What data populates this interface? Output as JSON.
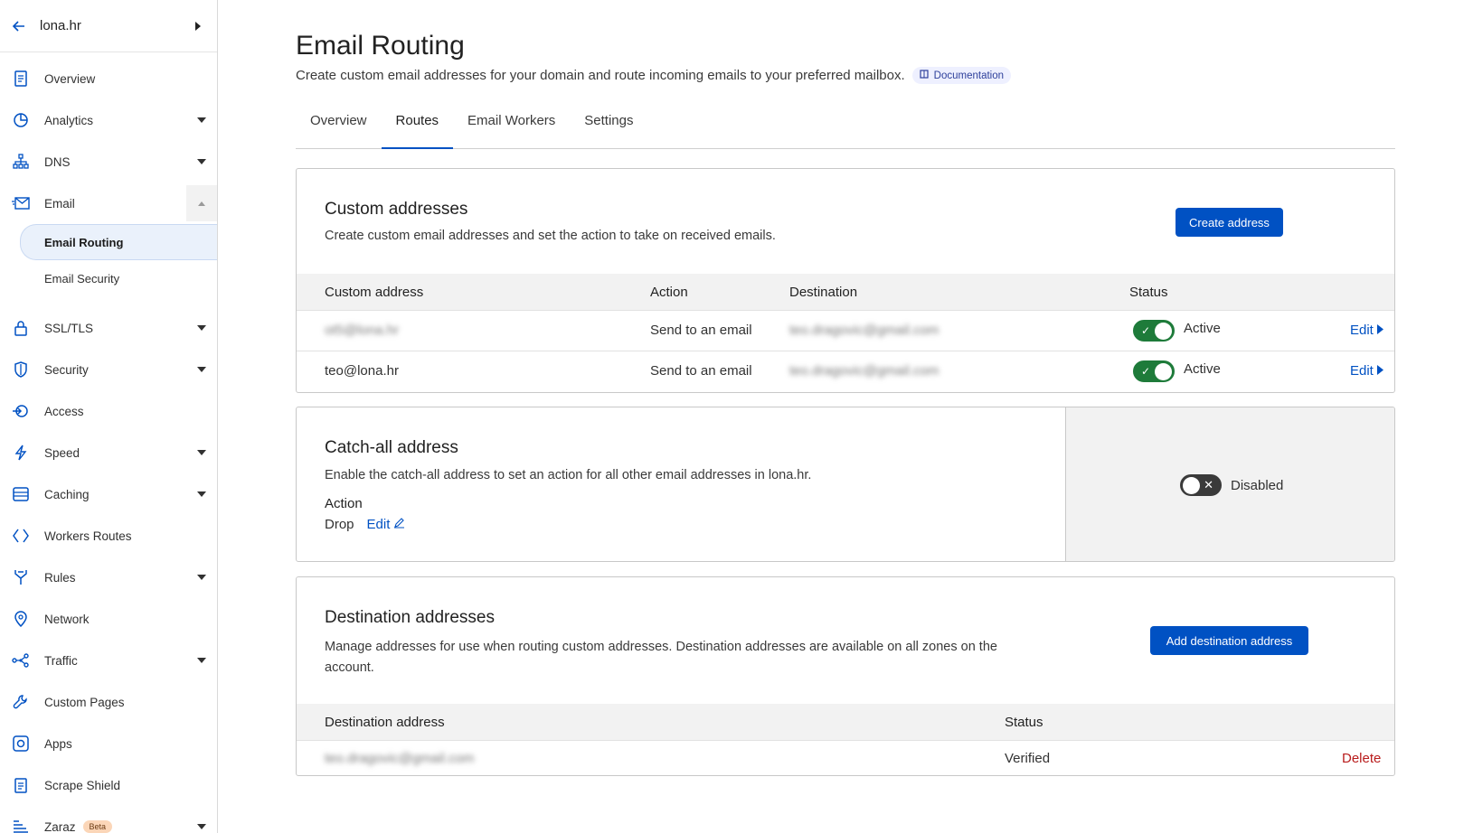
{
  "zone": {
    "name": "lona.hr"
  },
  "sidebar": {
    "items": [
      {
        "label": "Overview",
        "icon": "document-icon",
        "caret": false
      },
      {
        "label": "Analytics",
        "icon": "pie-chart-icon",
        "caret": true
      },
      {
        "label": "DNS",
        "icon": "network-tree-icon",
        "caret": true
      },
      {
        "label": "Email",
        "icon": "envelope-icon",
        "caret": "open"
      }
    ],
    "email_sub": [
      "Email Routing",
      "Email Security"
    ],
    "items2": [
      {
        "label": "SSL/TLS",
        "icon": "lock-icon",
        "caret": true
      },
      {
        "label": "Security",
        "icon": "shield-icon",
        "caret": true
      },
      {
        "label": "Access",
        "icon": "access-icon",
        "caret": false
      },
      {
        "label": "Speed",
        "icon": "lightning-icon",
        "caret": true
      },
      {
        "label": "Caching",
        "icon": "server-icon",
        "caret": true
      },
      {
        "label": "Workers Routes",
        "icon": "diamond-code-icon",
        "caret": false
      },
      {
        "label": "Rules",
        "icon": "fork-icon",
        "caret": true
      },
      {
        "label": "Network",
        "icon": "location-pin-icon",
        "caret": false
      },
      {
        "label": "Traffic",
        "icon": "share-nodes-icon",
        "caret": true
      },
      {
        "label": "Custom Pages",
        "icon": "wrench-icon",
        "caret": false
      },
      {
        "label": "Apps",
        "icon": "apps-icon",
        "caret": false
      },
      {
        "label": "Scrape Shield",
        "icon": "clipboard-icon",
        "caret": false
      },
      {
        "label": "Zaraz",
        "icon": "zaraz-icon",
        "caret": true,
        "badge": "Beta"
      }
    ]
  },
  "page": {
    "title": "Email Routing",
    "subtitle": "Create custom email addresses for your domain and route incoming emails to your preferred mailbox.",
    "doc_label": "Documentation",
    "tabs": [
      "Overview",
      "Routes",
      "Email Workers",
      "Settings"
    ]
  },
  "custom": {
    "title": "Custom addresses",
    "desc": "Create custom email addresses and set the action to take on received emails.",
    "button": "Create address",
    "headers": [
      "Custom address",
      "Action",
      "Destination",
      "Status"
    ],
    "rows": [
      {
        "address": "ot5@lona.hr",
        "action": "Send to an email",
        "destination": "teo.dragovic@gmail.com",
        "status": "Active",
        "edit": "Edit",
        "blur_address": true
      },
      {
        "address": "teo@lona.hr",
        "action": "Send to an email",
        "destination": "teo.dragovic@gmail.com",
        "status": "Active",
        "edit": "Edit",
        "blur_address": false
      }
    ]
  },
  "catchall": {
    "title": "Catch-all address",
    "desc": "Enable the catch-all address to set an action for all other email addresses in lona.hr.",
    "action_label": "Action",
    "action_value": "Drop",
    "edit": "Edit",
    "status": "Disabled"
  },
  "destination": {
    "title": "Destination addresses",
    "desc": "Manage addresses for use when routing custom addresses. Destination addresses are available on all zones on the account.",
    "button": "Add destination address",
    "headers": [
      "Destination address",
      "Status"
    ],
    "rows": [
      {
        "address": "teo.dragovic@gmail.com",
        "status": "Verified",
        "action": "Delete"
      }
    ]
  },
  "colors": {
    "accent": "#0051c3",
    "success": "#1e7b3a",
    "danger": "#b91c1c"
  }
}
